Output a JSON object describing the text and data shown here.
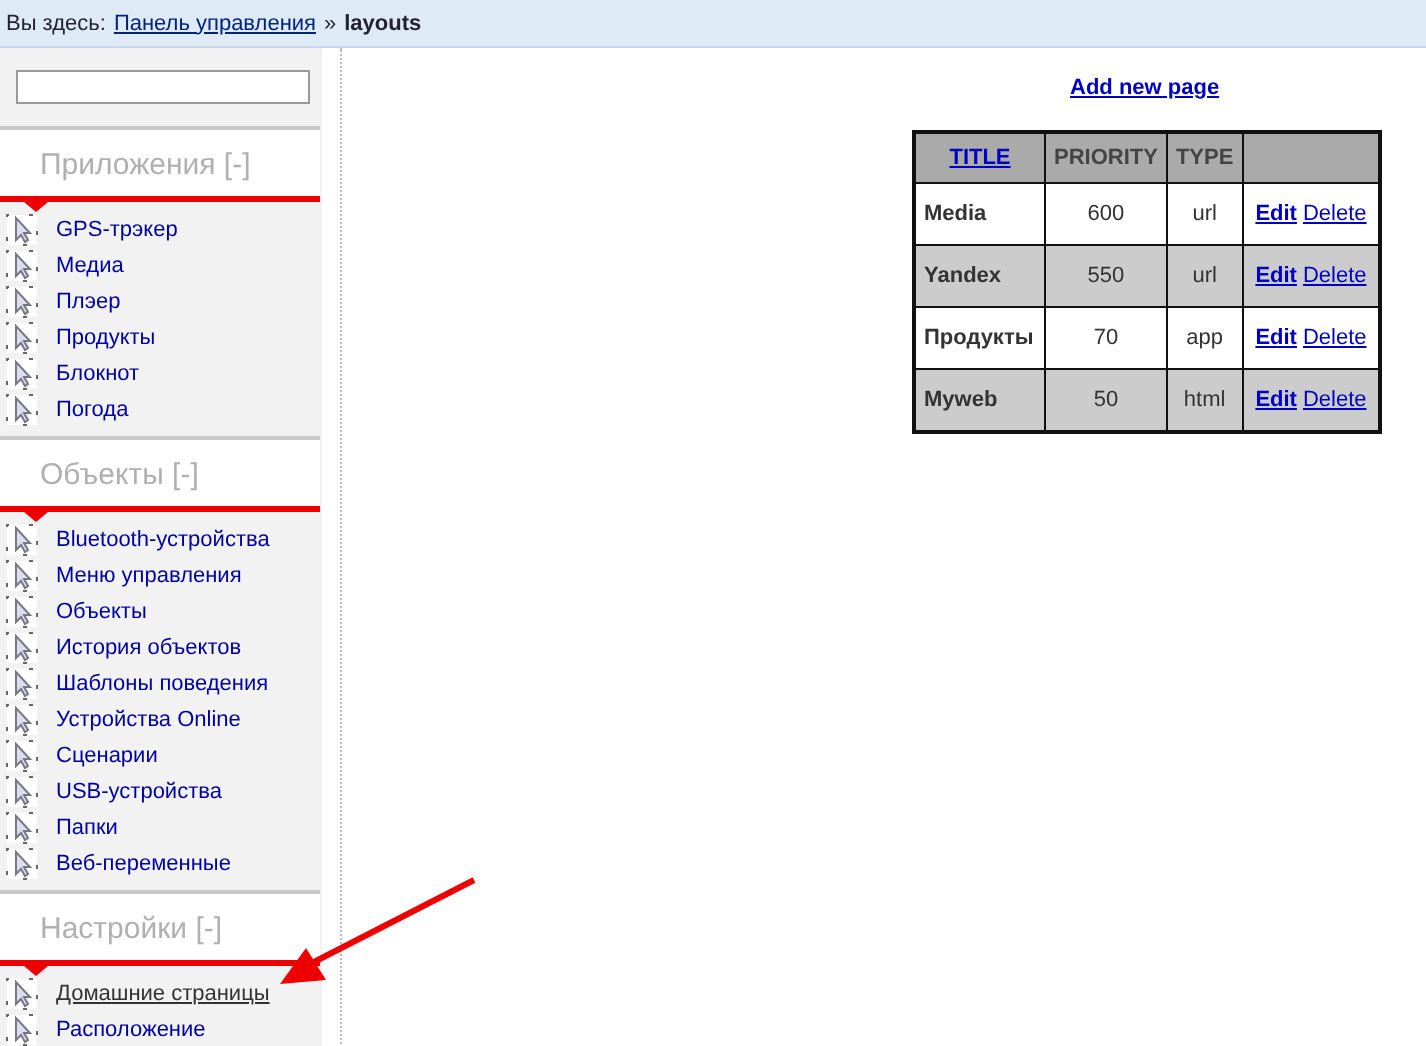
{
  "breadcrumb": {
    "prefix": "Вы здесь:",
    "link": "Панель управления",
    "separator": "»",
    "current": "layouts"
  },
  "sidebar": {
    "sections": [
      {
        "title": "Приложения [-]",
        "items": [
          {
            "label": "GPS-трэкер",
            "selected": false
          },
          {
            "label": "Медиа",
            "selected": false
          },
          {
            "label": "Плэер",
            "selected": false
          },
          {
            "label": "Продукты",
            "selected": false
          },
          {
            "label": "Блокнот",
            "selected": false
          },
          {
            "label": "Погода",
            "selected": false
          }
        ]
      },
      {
        "title": "Объекты [-]",
        "items": [
          {
            "label": "Bluetooth-устройства",
            "selected": false
          },
          {
            "label": "Меню управления",
            "selected": false
          },
          {
            "label": "Объекты",
            "selected": false
          },
          {
            "label": "История объектов",
            "selected": false
          },
          {
            "label": "Шаблоны поведения",
            "selected": false
          },
          {
            "label": "Устройства Online",
            "selected": false
          },
          {
            "label": "Сценарии",
            "selected": false
          },
          {
            "label": "USB-устройства",
            "selected": false
          },
          {
            "label": "Папки",
            "selected": false
          },
          {
            "label": "Веб-переменные",
            "selected": false
          }
        ]
      },
      {
        "title": "Настройки [-]",
        "items": [
          {
            "label": "Домашние страницы",
            "selected": true
          },
          {
            "label": "Расположение",
            "selected": false
          }
        ]
      }
    ]
  },
  "add_link": "Add new page",
  "table": {
    "columns": [
      "TITLE",
      "PRIORITY",
      "TYPE"
    ],
    "rows": [
      {
        "title": "Media",
        "priority": "600",
        "type": "url",
        "actions": [
          "Edit",
          "Delete"
        ]
      },
      {
        "title": "Yandex",
        "priority": "550",
        "type": "url",
        "actions": [
          "Edit",
          "Delete"
        ]
      },
      {
        "title": "Продукты",
        "priority": "70",
        "type": "app",
        "actions": [
          "Edit",
          "Delete"
        ]
      },
      {
        "title": "Myweb",
        "priority": "50",
        "type": "html",
        "actions": [
          "Edit",
          "Delete"
        ]
      }
    ]
  }
}
